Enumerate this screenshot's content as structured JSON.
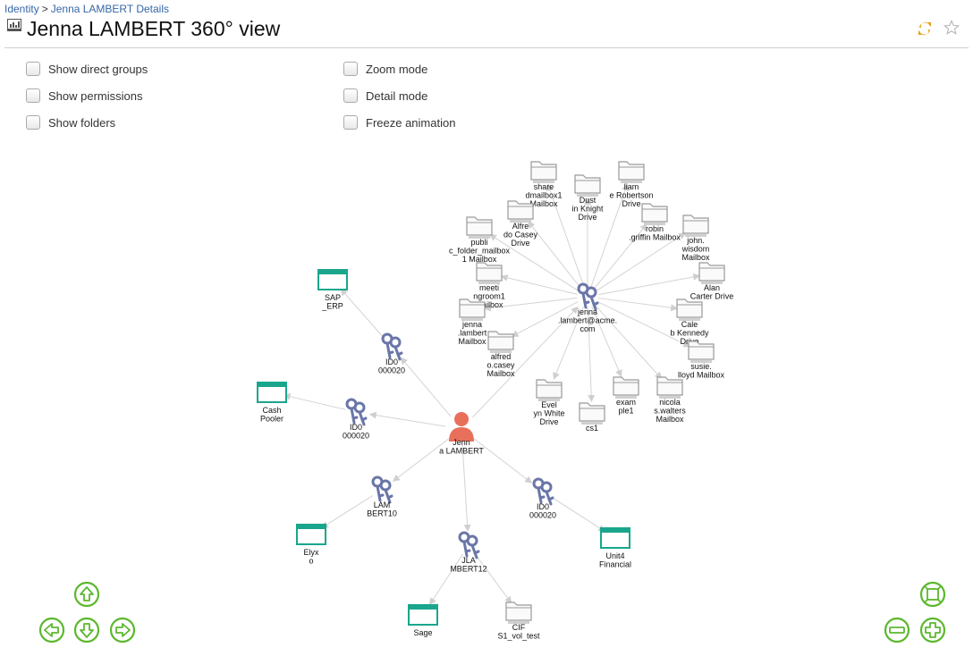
{
  "breadcrumb": {
    "root": "Identity",
    "separator": ">",
    "current": "Jenna LAMBERT Details"
  },
  "title": "Jenna LAMBERT 360° view",
  "options": {
    "show_direct_groups": "Show direct groups",
    "show_permissions": "Show permissions",
    "show_folders": "Show folders",
    "zoom_mode": "Zoom mode",
    "detail_mode": "Detail mode",
    "freeze_animation": "Freeze animation"
  },
  "colors": {
    "accent": "#3567a8",
    "teal": "#1aa68c",
    "key": "#6a76a8",
    "person": "#e8705a",
    "nav_green": "#5cb82e",
    "folder": "#9a9a9a"
  },
  "graph": {
    "person": [
      "Jenn",
      "a LAMBERT"
    ],
    "nodes": {
      "account_center": [
        "jenna",
        ".lambert@acme.",
        "com"
      ],
      "key_sap": [
        "ID0",
        "000020"
      ],
      "key_cash": [
        "ID0",
        "000020"
      ],
      "key_lam10": [
        "LAM",
        "BERT10"
      ],
      "key_jla12": [
        "JLA",
        "MBERT12"
      ],
      "key_unit4": [
        "ID0",
        "000020"
      ],
      "app_sap": [
        "SAP",
        "_ERP"
      ],
      "app_cash": [
        "Cash",
        "Pooler"
      ],
      "app_elyxo": [
        "Elyx",
        "o"
      ],
      "app_sage": [
        "Sage"
      ],
      "app_unit4": [
        "Unit4",
        "Financial"
      ],
      "folder_cif": [
        "CIF",
        "S1_vol_test"
      ],
      "f_shared": [
        "share",
        "dmailbox1",
        "Mailbox"
      ],
      "f_dustin": [
        "Dust",
        "in Knight",
        "Drive"
      ],
      "f_liam": [
        "liam",
        "e Robertson",
        "Drive"
      ],
      "f_alfredo_drive": [
        "Alfre",
        "do Casey",
        "Drive"
      ],
      "f_robin": [
        "robin",
        ".griffin Mailbox"
      ],
      "f_john": [
        "john.",
        "wisdom",
        "Mailbox"
      ],
      "f_public": [
        "publi",
        "c_folder_mailbox",
        "1 Mailbox"
      ],
      "f_alan": [
        "Alan",
        "Carter Drive"
      ],
      "f_meeting": [
        "meeti",
        "ngroom1",
        "Mailbox"
      ],
      "f_caleb": [
        "Cale",
        "b Kennedy",
        "Drive"
      ],
      "f_jenna_mb": [
        "jenna",
        ".lambert",
        "Mailbox"
      ],
      "f_susie": [
        "susie.",
        "lloyd Mailbox"
      ],
      "f_alfredo_mb": [
        "alfred",
        "o.casey",
        "Mailbox"
      ],
      "f_evelyn": [
        "Evel",
        "yn White",
        "Drive"
      ],
      "f_cs1": [
        "cs1"
      ],
      "f_example": [
        "exam",
        "ple1"
      ],
      "f_nicola": [
        "nicola",
        "s.walters",
        "Mailbox"
      ]
    }
  }
}
